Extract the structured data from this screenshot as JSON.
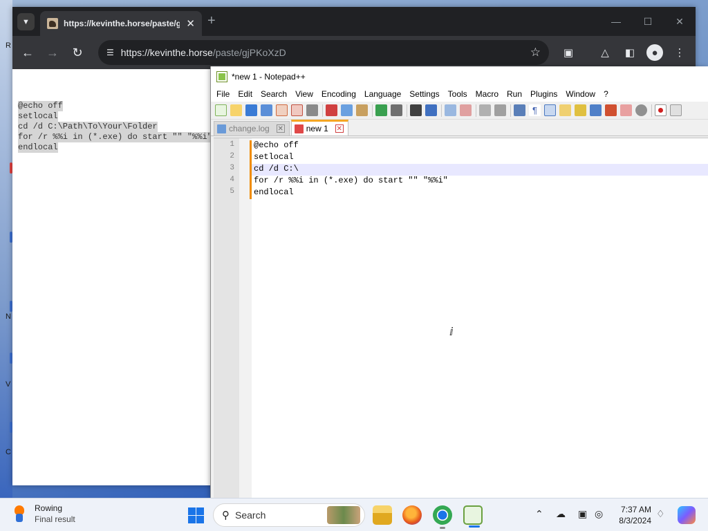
{
  "browser": {
    "tab_title": "https://kevinthe.horse/paste/gjPKoXzD",
    "url_host": "https://kevinthe.horse",
    "url_path": "/paste/gjPKoXzD",
    "paste_lines": [
      "@echo off",
      "setlocal",
      "cd /d C:\\Path\\To\\Your\\Folder",
      "for /r %%i in (*.exe) do start \"\" \"%%i\"",
      "endlocal"
    ]
  },
  "notepad": {
    "window_title": "*new 1 - Notepad++",
    "menu": [
      "File",
      "Edit",
      "Search",
      "View",
      "Encoding",
      "Language",
      "Settings",
      "Tools",
      "Macro",
      "Run",
      "Plugins",
      "Window",
      "?"
    ],
    "tabs": [
      {
        "label": "change.log",
        "active": false
      },
      {
        "label": "new 1",
        "active": true
      }
    ],
    "lines": [
      {
        "no": "1",
        "text": "@echo off"
      },
      {
        "no": "2",
        "text": "setlocal"
      },
      {
        "no": "3",
        "text": "cd /d C:\\"
      },
      {
        "no": "4",
        "text": "for /r %%i in (*.exe) do start \"\" \"%%i\""
      },
      {
        "no": "5",
        "text": "endlocal"
      }
    ]
  },
  "taskbar": {
    "weather_title": "Rowing",
    "weather_subtitle": "Final result",
    "search_placeholder": "Search",
    "time": "7:37 AM",
    "date": "8/3/2024"
  },
  "colors": {
    "accent": "#1a74e8",
    "npp_active_tab": "#f5a623",
    "current_line": "#e8e8ff"
  },
  "icons": [
    "dropdown-icon",
    "close-icon",
    "plus-icon",
    "back-icon",
    "forward-icon",
    "reload-icon",
    "site-info-icon",
    "star-icon",
    "extensions-icon",
    "labs-icon",
    "sidepanel-icon",
    "profile-icon",
    "menu-icon",
    "windows-start-icon",
    "search-icon",
    "explorer-icon",
    "firefox-icon",
    "chrome-icon",
    "notepadpp-icon",
    "chevron-up-icon",
    "onedrive-icon",
    "display-icon",
    "network-icon",
    "bell-icon",
    "copilot-icon"
  ]
}
